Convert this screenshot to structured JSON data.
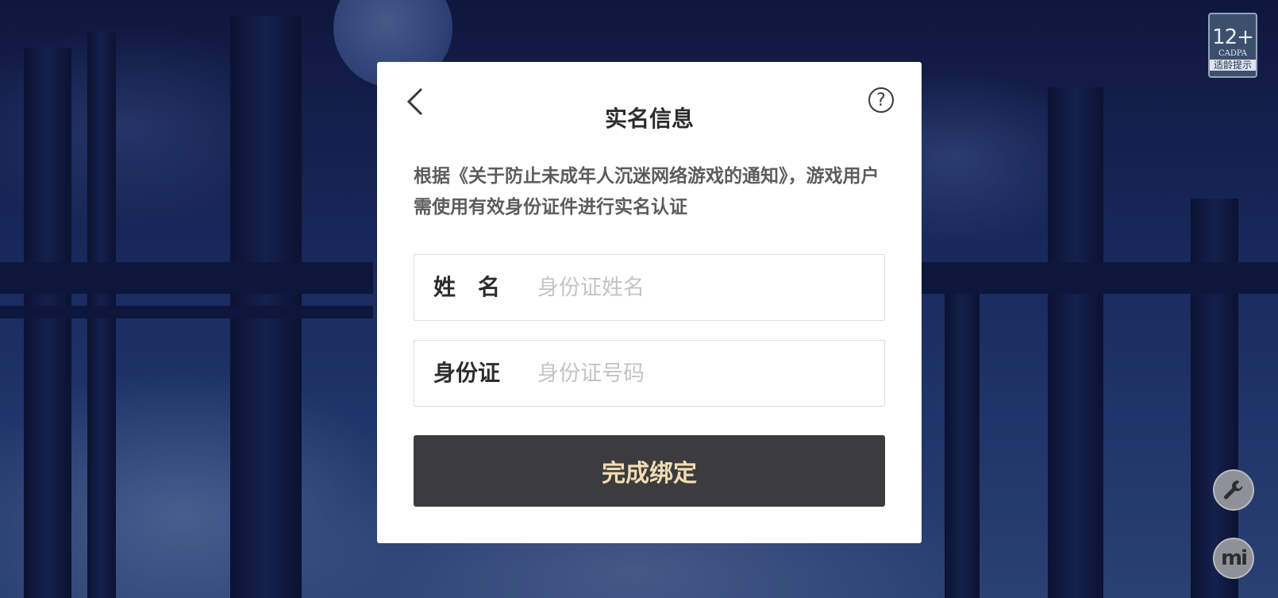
{
  "age_rating": {
    "age": "12+",
    "org": "CADPA",
    "tip": "适龄提示"
  },
  "dialog": {
    "title": "实名信息",
    "notice": "根据《关于防止未成年人沉迷网络游戏的通知》，游戏用户需使用有效身份证件进行实名认证",
    "help_glyph": "?",
    "fields": [
      {
        "label": "姓　名",
        "placeholder": "身份证姓名",
        "value": ""
      },
      {
        "label": "身份证",
        "placeholder": "身份证号码",
        "value": ""
      }
    ],
    "submit_label": "完成绑定"
  },
  "side_buttons": {
    "tools_icon": "wrench-icon",
    "account_logo": "mi"
  },
  "colors": {
    "submit_bg": "#3c3c3e",
    "submit_text": "#f2dcb2",
    "dialog_bg": "#ffffff"
  }
}
